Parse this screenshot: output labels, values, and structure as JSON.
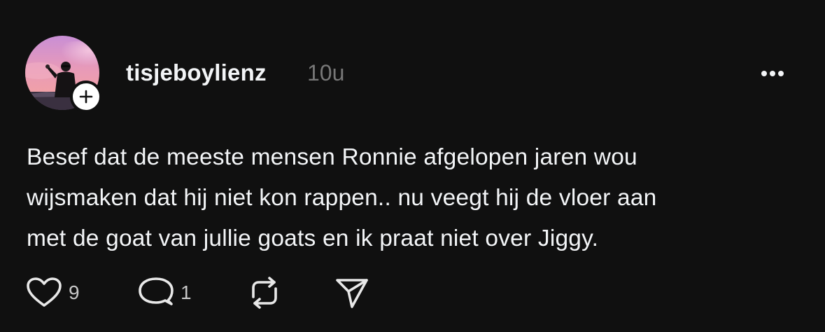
{
  "post": {
    "author": {
      "username": "tisjeboylienz",
      "timestamp": "10u",
      "avatar_icon": "avatar-photo",
      "follow_icon": "plus-icon"
    },
    "text_lines": [
      "Besef dat de meeste mensen Ronnie afgelopen jaren wou",
      "wijsmaken dat hij niet kon rappen.. nu veegt hij de vloer aan",
      "met de goat van jullie goats en ik praat niet over Jiggy."
    ],
    "actions": {
      "like": {
        "icon": "heart-icon",
        "count": "9"
      },
      "reply": {
        "icon": "comment-icon",
        "count": "1"
      },
      "repost": {
        "icon": "repost-icon"
      },
      "share": {
        "icon": "send-icon"
      }
    },
    "more_icon": "more-icon"
  },
  "colors": {
    "background": "#101010",
    "text": "#f3f5f7",
    "secondary": "#777777"
  }
}
